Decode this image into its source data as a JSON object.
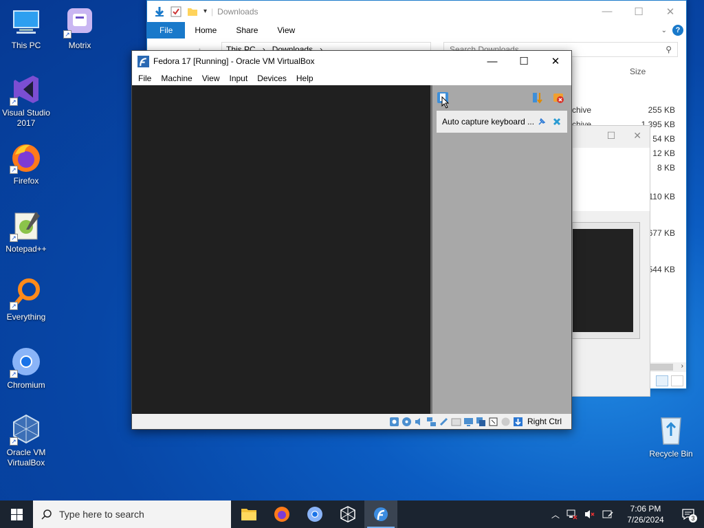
{
  "desktop": {
    "icons": [
      {
        "label": "This PC"
      },
      {
        "label": "Motrix"
      },
      {
        "label": "Visual Studio 2017"
      },
      {
        "label": "Firefox"
      },
      {
        "label": "Notepad++"
      },
      {
        "label": "Everything"
      },
      {
        "label": "Chromium"
      },
      {
        "label": "Oracle VM VirtualBox"
      }
    ],
    "recycle_bin": "Recycle Bin"
  },
  "explorer": {
    "title": "Downloads",
    "tabs": [
      "File",
      "Home",
      "Share",
      "View"
    ],
    "breadcrumb": [
      "This PC",
      "Downloads"
    ],
    "search_placeholder": "Search Downloads",
    "size_header": "Size",
    "types": [
      "chive",
      "chive"
    ],
    "sizes": [
      "255 KB",
      "1,395 KB",
      "54 KB",
      "12 KB",
      "8 KB",
      "",
      "110 KB",
      "",
      "677 KB",
      "",
      "544 KB"
    ],
    "help": "?"
  },
  "vbox": {
    "title": "Fedora 17 [Running] - Oracle VM VirtualBox",
    "menu": [
      "File",
      "Machine",
      "View",
      "Input",
      "Devices",
      "Help"
    ],
    "notification": "Auto capture keyboard ...",
    "host_key": "Right Ctrl"
  },
  "taskbar": {
    "search_placeholder": "Type here to search",
    "time": "7:06 PM",
    "date": "7/26/2024",
    "notification_count": "3"
  },
  "colors": {
    "accent": "#1979ca",
    "taskbar": "#1b2430",
    "vm_screen": "#202020",
    "vm_panel": "#a8a8a8"
  }
}
